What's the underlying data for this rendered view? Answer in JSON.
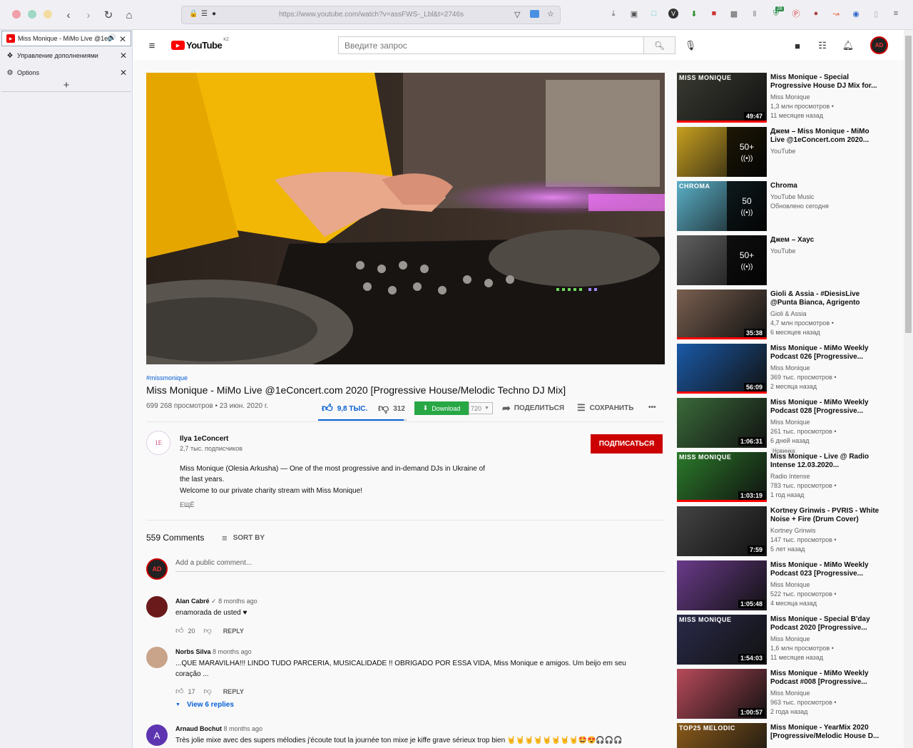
{
  "browser": {
    "url": "https://www.youtube.com/watch?v=assFWS-_Lbl&t=2746s",
    "tabs": [
      {
        "label": "Miss Monique - MiMo Live @1eC"
      },
      {
        "label": "Управление дополнениями"
      },
      {
        "label": "Options"
      }
    ],
    "new_tab": "+",
    "badge_count": "28"
  },
  "header": {
    "logo_text": "YouTube",
    "region": "KZ",
    "search_placeholder": "Введите запрос"
  },
  "video": {
    "hashtag": "#missmonique",
    "title": "Miss Monique - MiMo Live @1eConcert.com 2020 [Progressive House/Melodic Techno DJ Mix]",
    "views_date": "699 268 просмотров • 23 июн. 2020 г.",
    "likes": "9,8 ТЫС.",
    "dislikes": "312",
    "download_label": "Download",
    "quality": "720",
    "share_label": "ПОДЕЛИТЬСЯ",
    "save_label": "СОХРАНИТЬ",
    "more": "•••"
  },
  "channel": {
    "avatar_text": "1E",
    "name": "Ilya 1eConcert",
    "subs": "2,7 тыс. подписчиков",
    "subscribe_label": "ПОДПИСАТЬСЯ",
    "desc_lines": [
      "Miss Monique (Olesia Arkusha) — One of the most progressive and in-demand DJs in Ukraine of",
      "the last years.",
      "Welcome to our private charity stream with Miss Monique!"
    ],
    "more_label": "ЕЩЁ"
  },
  "comments": {
    "count_label": "559 Comments",
    "sort_label": "SORT BY",
    "add_placeholder": "Add a public comment...",
    "reply_label": "REPLY",
    "items": [
      {
        "author": "Alan Cabré",
        "time": "8 months ago",
        "lines": [
          "enamorada de usted ♥"
        ],
        "likes": "20"
      },
      {
        "author": "Norbs Silva",
        "time": "8 months ago",
        "lines": [
          "...QUE MARAVILHA!!!  LINDO TUDO PARCERIA, MUSICALIDADE !! OBRIGADO POR ESSA VIDA, Miss Monique e amigos. Um beijo em seu",
          "coração ..."
        ],
        "likes": "17",
        "view_replies": "View 6 replies"
      },
      {
        "author": "Arnaud Bochut",
        "time": "8 months ago",
        "lines": [
          "Très jolie  mixe avec des supers mélodies j'écoute tout la journée  ton mixe  je kiffe grave sérieux  trop bien 🤘🤘🤘🤘🤘🤘🤘🤘🤩😍🎧🎧🎧"
        ],
        "avatar_letter": "A"
      }
    ]
  },
  "recommended": [
    {
      "title": "Miss Monique - Special Progressive House DJ Mix for...",
      "channel": "Miss Monique",
      "views": "1,3 млн просмотров •",
      "age": "11 месяцев назад",
      "duration": "49:47",
      "thumb_label": "MISS MONIQUE"
    },
    {
      "title": "Джем – Miss Monique - MiMo Live @1eConcert.com 2020...",
      "channel": "YouTube",
      "overlay": "50+"
    },
    {
      "title": "Chroma",
      "channel": "YouTube Music",
      "views": "Обновлено сегодня",
      "overlay": "50",
      "thumb_label": "CHROMA"
    },
    {
      "title": "Джем – Хаус",
      "channel": "YouTube",
      "overlay": "50+"
    },
    {
      "title": "Gioli & Assia - #DiesisLive @Punta Bianca, Agrigento",
      "channel": "Gioli & Assia",
      "views": "4,7 млн просмотров •",
      "age": "6 месяцев назад",
      "duration": "35:38"
    },
    {
      "title": "Miss Monique - MiMo Weekly Podcast 026 [Progressive...",
      "channel": "Miss Monique",
      "views": "369 тыс. просмотров •",
      "age": "2 месяца назад",
      "duration": "56:09"
    },
    {
      "title": "Miss Monique - MiMo Weekly Podcast 028 [Progressive...",
      "channel": "Miss Monique",
      "views": "261 тыс. просмотров •",
      "age": "6 дней назад",
      "badge": "Новинка",
      "duration": "1:06:31"
    },
    {
      "title": "Miss Monique - Live @ Radio Intense 12.03.2020...",
      "channel": "Radio Intense",
      "views": "783 тыс. просмотров •",
      "age": "1 год назад",
      "duration": "1:03:19",
      "thumb_label": "MISS MONIQUE"
    },
    {
      "title": "Kortney Grinwis - PVRIS - White Noise + Fire (Drum Cover)",
      "channel": "Kortney Grinwis",
      "views": "147 тыс. просмотров •",
      "age": "5 лет назад",
      "duration": "7:59"
    },
    {
      "title": "Miss Monique - MiMo Weekly Podcast 023 [Progressive...",
      "channel": "Miss Monique",
      "views": "522 тыс. просмотров •",
      "age": "4 месяца назад",
      "duration": "1:05:48"
    },
    {
      "title": "Miss Monique - Special B'day Podcast 2020 [Progressive...",
      "channel": "Miss Monique",
      "views": "1,6 млн просмотров •",
      "age": "11 месяцев назад",
      "duration": "1:54:03",
      "thumb_label": "MISS MONIQUE"
    },
    {
      "title": "Miss Monique - MiMo Weekly Podcast #008 [Progressive...",
      "channel": "Miss Monique",
      "views": "963 тыс. просмотров •",
      "age": "2 года назад",
      "duration": "1:00:57"
    },
    {
      "title": "Miss Monique - YearMix 2020 [Progressive/Melodic House D...",
      "thumb_label": "TOP25 MELODIC"
    }
  ]
}
